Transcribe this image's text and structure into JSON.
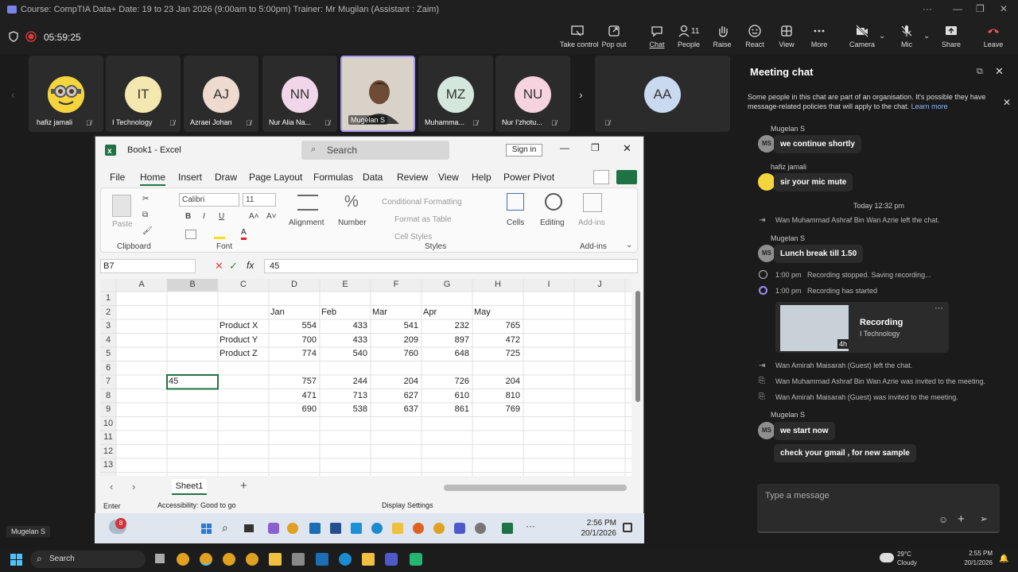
{
  "titlebar": {
    "title": "Course: CompTIA Data+ Date: 19 to 23 Jan 2026 (9:00am to 5:00pm) Trainer: Mr Mugilan (Assistant : Zaim)"
  },
  "meeting": {
    "timer": "05:59:25",
    "toolbar": [
      {
        "label": "Take control",
        "icon": "take-control-icon"
      },
      {
        "label": "Pop out",
        "icon": "pop-out-icon"
      },
      {
        "label": "Chat",
        "icon": "chat-icon"
      },
      {
        "label": "People",
        "icon": "people-icon",
        "count": "11"
      },
      {
        "label": "Raise",
        "icon": "raise-hand-icon"
      },
      {
        "label": "React",
        "icon": "react-icon"
      },
      {
        "label": "View",
        "icon": "view-icon"
      },
      {
        "label": "More",
        "icon": "more-icon"
      },
      {
        "label": "Camera",
        "icon": "camera-off-icon"
      },
      {
        "label": "Mic",
        "icon": "mic-off-icon"
      },
      {
        "label": "Share",
        "icon": "share-icon"
      },
      {
        "label": "Leave",
        "icon": "leave-icon"
      }
    ],
    "participants": [
      {
        "name": "hafiz jamali",
        "initials": "",
        "color": "#f0d040"
      },
      {
        "name": "I Technology",
        "initials": "IT",
        "color": "#f5e7b0"
      },
      {
        "name": "Azraei Johan",
        "initials": "AJ",
        "color": "#efdad0"
      },
      {
        "name": "Nur Alia Na...",
        "initials": "NN",
        "color": "#f0d6e8"
      },
      {
        "name": "Mugelan S",
        "initials": "",
        "color": "#c9b9a5"
      },
      {
        "name": "Muhamma...",
        "initials": "MZ",
        "color": "#d4e7dc"
      },
      {
        "name": "Nur I'zhotu...",
        "initials": "NU",
        "color": "#f6d3df"
      },
      {
        "name": "",
        "initials": "AA",
        "color": "#c8d9f0"
      }
    ],
    "presenter_label": "Mugelan S"
  },
  "chat": {
    "title": "Meeting chat",
    "notice": "Some people in this chat are part of an organisation. It's possible they have message-related policies that will apply to the chat.",
    "learn_more": "Learn more",
    "messages": [
      {
        "sender": "Mugelan S",
        "initials": "MS",
        "text": "we continue shortly"
      },
      {
        "sender": "hafiz jamali",
        "initials": "",
        "text": "sir your mic mute"
      }
    ],
    "date_sep": "Today 12:32 pm",
    "sys1": "Wan Muhammad Ashraf Bin Wan Azrie left the chat.",
    "msg3_sender": "Mugelan S",
    "msg3_initials": "MS",
    "msg3_text": "Lunch break till 1.50",
    "rec1_time": "1:00 pm",
    "rec1_text": "Recording stopped. Saving recording...",
    "rec2_time": "1:00 pm",
    "rec2_text": "Recording has started",
    "rec_card_title": "Recording",
    "rec_card_owner": "I Technology",
    "rec_card_duration": "4h",
    "sys2": "Wan Amirah Maisarah (Guest) left the chat.",
    "sys3": "Wan Muhammad Ashraf Bin Wan Azrie was invited to the meeting.",
    "sys4": "Wan Amirah Maisarah (Guest) was invited to the meeting.",
    "msg4_sender": "Mugelan S",
    "msg4_initials": "MS",
    "msg4_text": "we start now",
    "msg5_text": "check your gmail , for new sample",
    "input_placeholder": "Type a message"
  },
  "excel": {
    "title": "Book1  -  Excel",
    "search": "Search",
    "sign_in": "Sign in",
    "tabs": [
      "File",
      "Home",
      "Insert",
      "Draw",
      "Page Layout",
      "Formulas",
      "Data",
      "Review",
      "View",
      "Help",
      "Power Pivot"
    ],
    "font_name": "Calibri",
    "font_size": "11",
    "groups": {
      "clipboard": "Clipboard",
      "font": "Font",
      "styles": "Styles",
      "addins": "Add-ins"
    },
    "ribbon": {
      "paste": "Paste",
      "alignment": "Alignment",
      "number": "Number",
      "cond_format": "Conditional Formatting",
      "format_table": "Format as Table",
      "cell_styles": "Cell Styles",
      "cells": "Cells",
      "editing": "Editing",
      "addins_btn": "Add-ins"
    },
    "name_box": "B7",
    "formula": "45",
    "columns": [
      "A",
      "B",
      "C",
      "D",
      "E",
      "F",
      "G",
      "H",
      "I",
      "J"
    ],
    "rows": [
      "1",
      "2",
      "3",
      "4",
      "5",
      "6",
      "7",
      "8",
      "9",
      "10",
      "11",
      "12",
      "13"
    ],
    "months": [
      "Jan",
      "Feb",
      "Mar",
      "Apr",
      "May"
    ],
    "products": [
      "Product X",
      "Product Y",
      "Product Z"
    ],
    "table1": [
      [
        554,
        433,
        541,
        232,
        765
      ],
      [
        700,
        433,
        209,
        897,
        472
      ],
      [
        774,
        540,
        760,
        648,
        725
      ]
    ],
    "table2": [
      [
        757,
        244,
        204,
        726,
        204
      ],
      [
        471,
        713,
        627,
        610,
        810
      ],
      [
        690,
        538,
        637,
        861,
        769
      ]
    ],
    "active_value": "45",
    "sheet_tab": "Sheet1",
    "status_mode": "Enter",
    "accessibility": "Accessibility: Good to go",
    "display_settings": "Display Settings"
  },
  "inner_taskbar": {
    "badge": "8",
    "time": "2:56 PM",
    "date": "20/1/2026"
  },
  "host_taskbar": {
    "search": "Search",
    "weather_temp": "29°C",
    "weather_desc": "Cloudy",
    "time": "2:55 PM",
    "date": "20/1/2026"
  }
}
